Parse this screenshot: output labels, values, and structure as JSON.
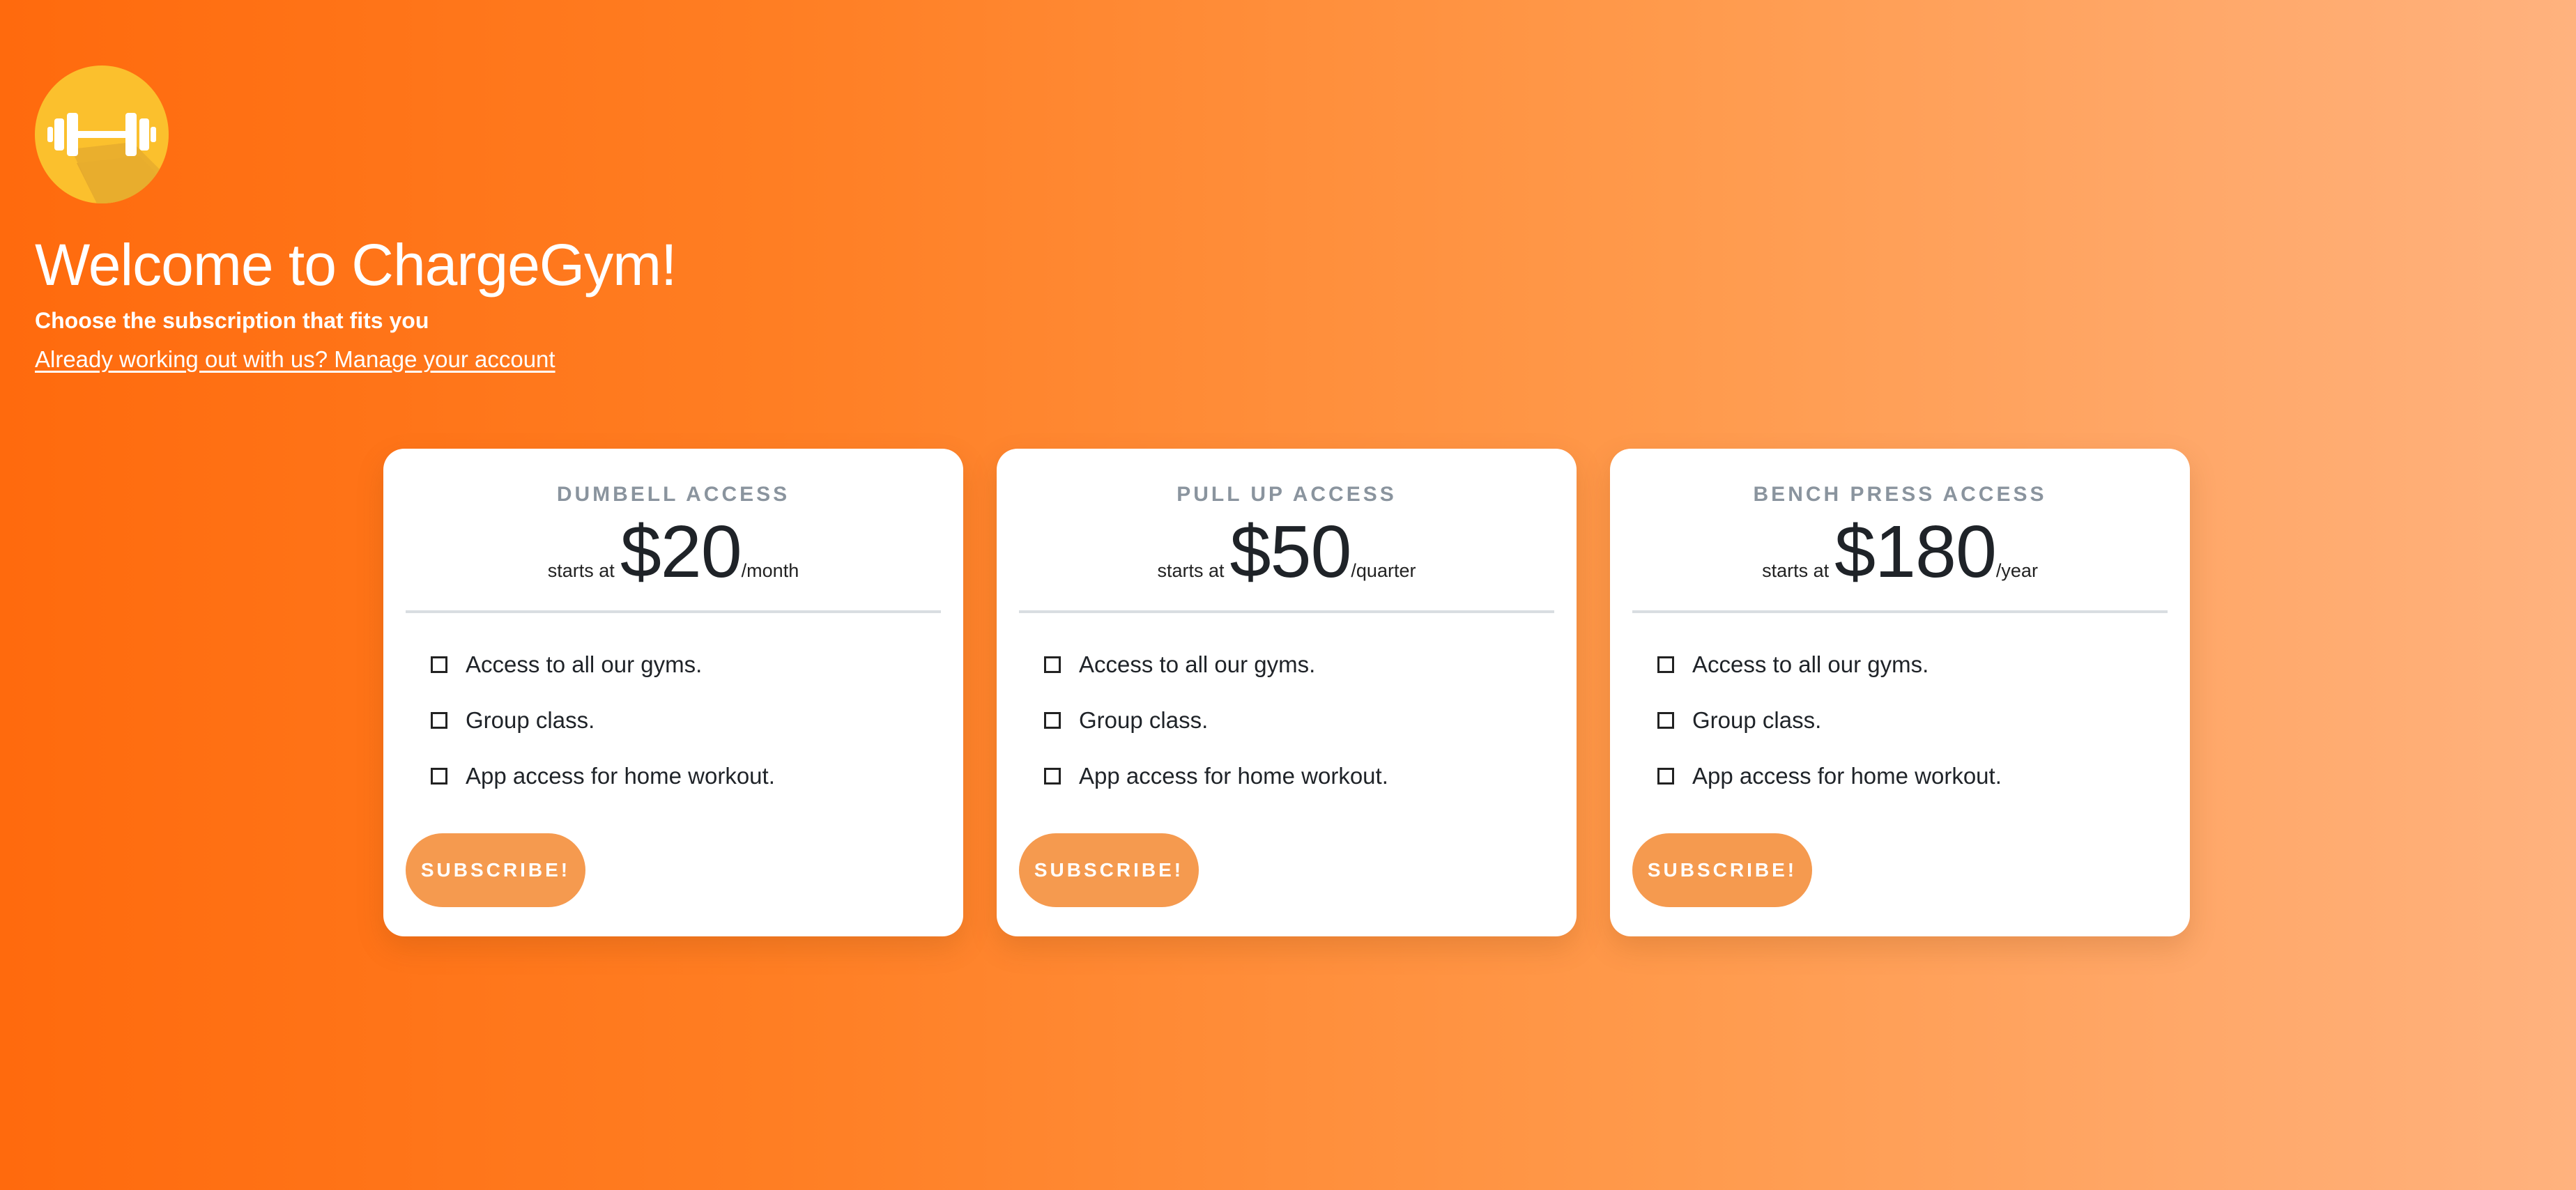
{
  "header": {
    "logo_icon": "dumbbell-icon",
    "title": "Welcome to ChargeGym!",
    "subtitle": "Choose the subscription that fits you",
    "manage_link": "Already working out with us? Manage your account"
  },
  "colors": {
    "gradient_start": "#ff6a0d",
    "gradient_end": "#ffb27e",
    "button": "#f59a4f",
    "logo_circle": "#fbc02d"
  },
  "plans": [
    {
      "name": "DUMBELL ACCESS",
      "starts_at": "starts at",
      "price": "$20",
      "period": "/month",
      "features": [
        "Access to all our gyms.",
        "Group class.",
        "App access for home workout."
      ],
      "button": "SUBSCRIBE!"
    },
    {
      "name": "PULL UP ACCESS",
      "starts_at": "starts at",
      "price": "$50",
      "period": "/quarter",
      "features": [
        "Access to all our gyms.",
        "Group class.",
        "App access for home workout."
      ],
      "button": "SUBSCRIBE!"
    },
    {
      "name": "BENCH PRESS ACCESS",
      "starts_at": "starts at",
      "price": "$180",
      "period": "/year",
      "features": [
        "Access to all our gyms.",
        "Group class.",
        "App access for home workout."
      ],
      "button": "SUBSCRIBE!"
    }
  ]
}
